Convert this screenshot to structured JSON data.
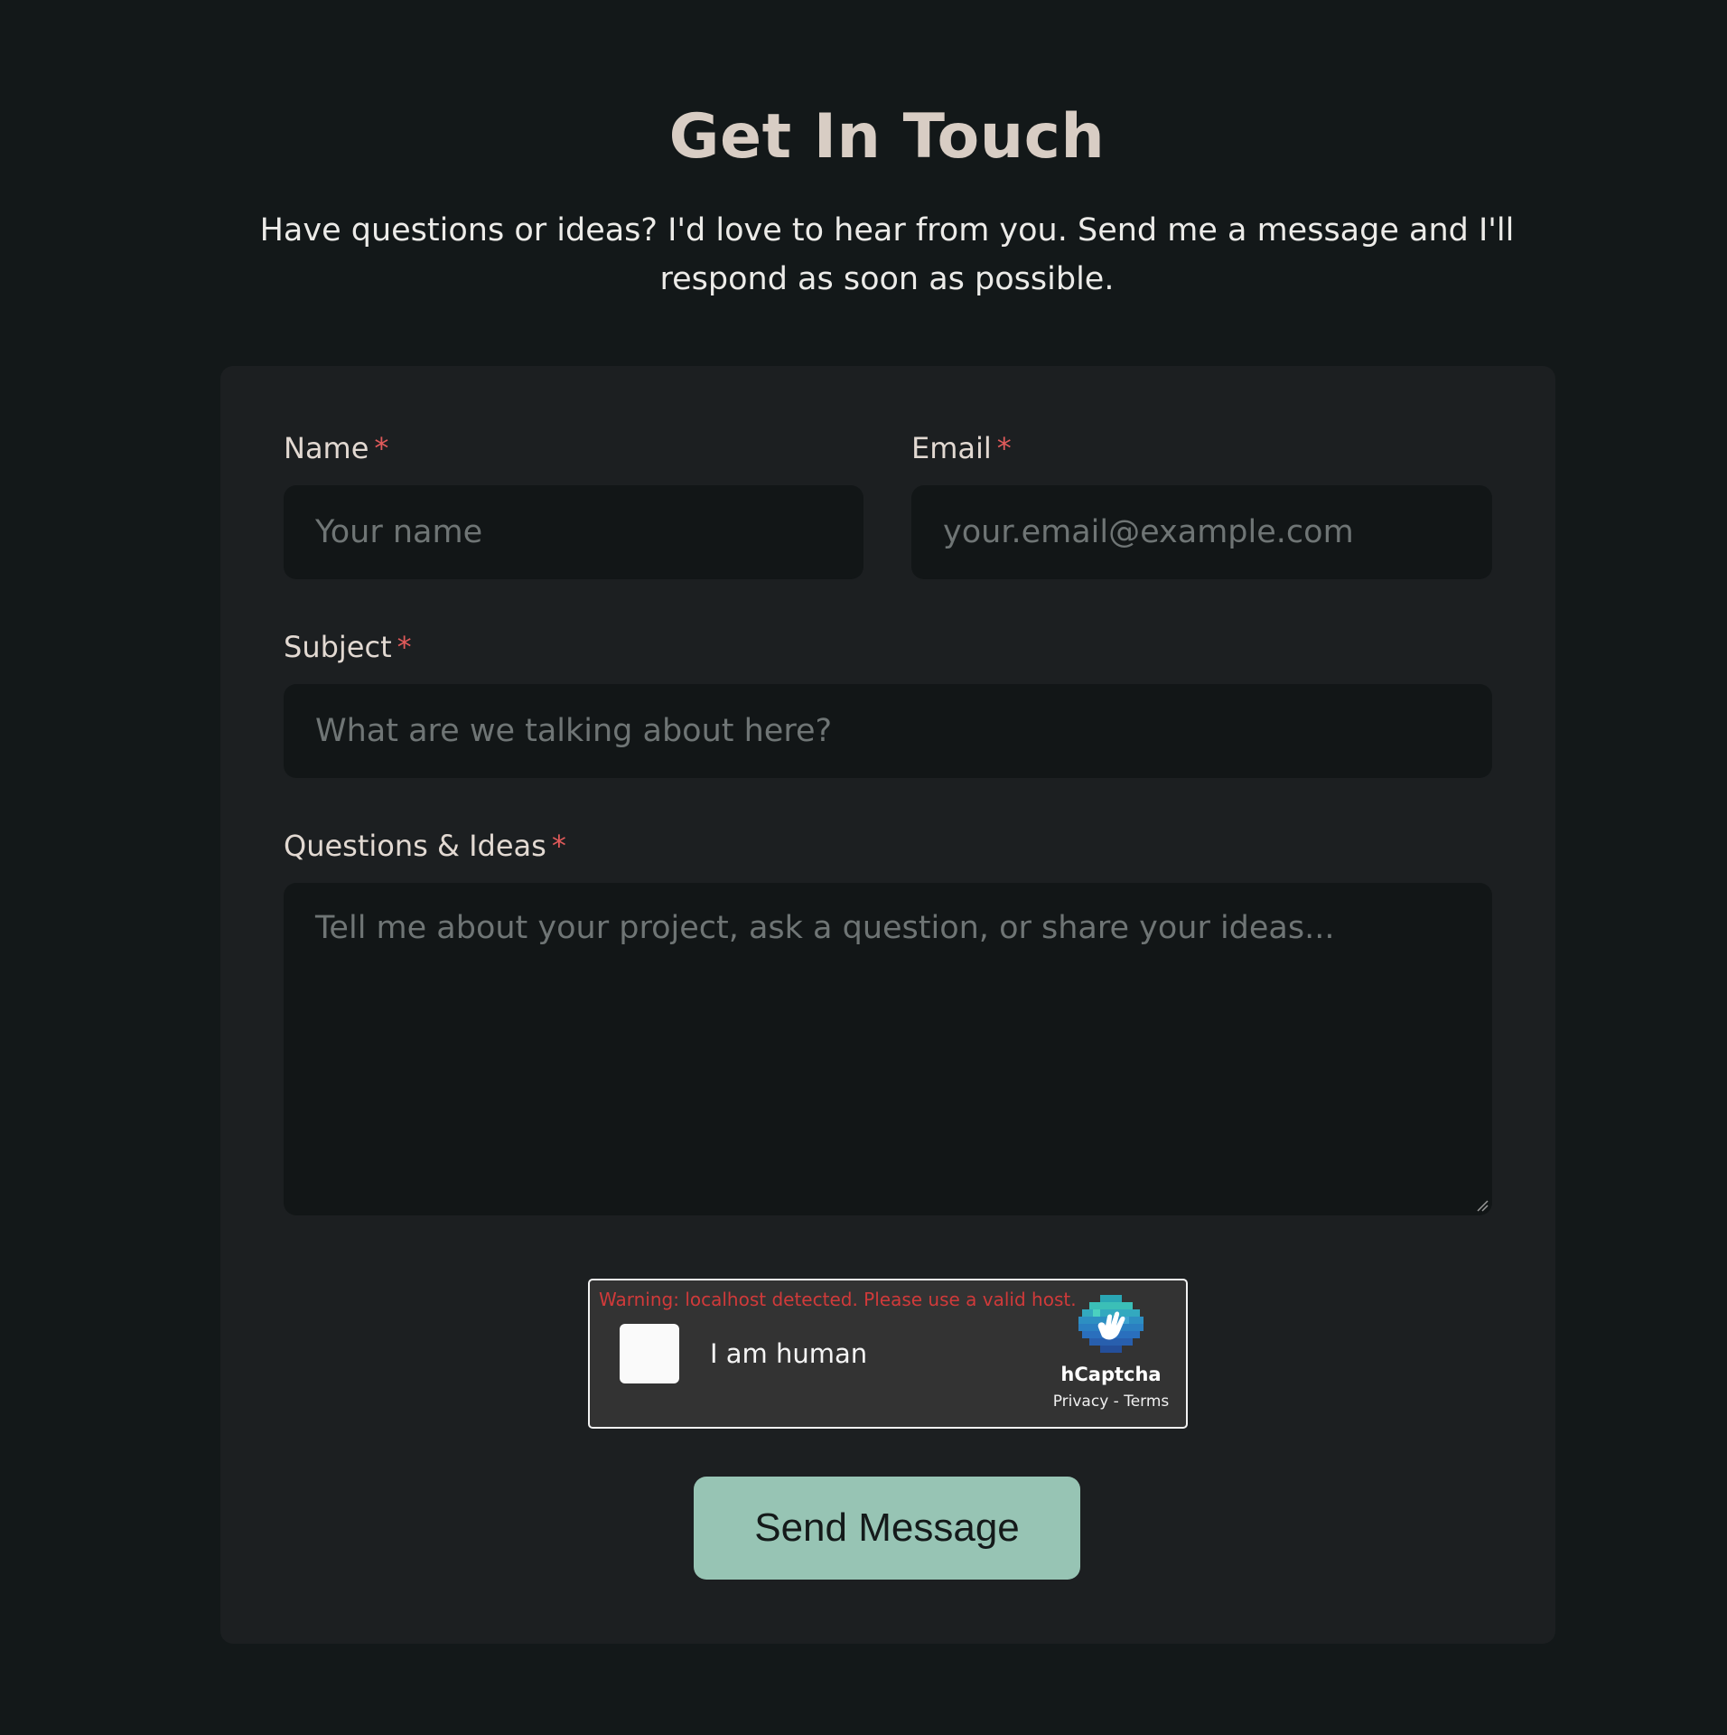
{
  "header": {
    "title": "Get In Touch",
    "subtitle": "Have questions or ideas? I'd love to hear from you. Send me a message and I'll respond as soon as possible."
  },
  "form": {
    "required_mark": "*",
    "name": {
      "label": "Name",
      "placeholder": "Your name"
    },
    "email": {
      "label": "Email",
      "placeholder": "your.email@example.com"
    },
    "subject": {
      "label": "Subject",
      "placeholder": "What are we talking about here?"
    },
    "message": {
      "label": "Questions & Ideas",
      "placeholder": "Tell me about your project, ask a question, or share your ideas..."
    },
    "submit_label": "Send Message"
  },
  "captcha": {
    "warning": "Warning: localhost detected. Please use a valid host.",
    "checkbox_label": "I am human",
    "brand": "hCaptcha",
    "privacy_link": "Privacy",
    "separator": " - ",
    "terms_link": "Terms"
  },
  "colors": {
    "background": "#131819",
    "card": "#1c1f21",
    "input": "#121617",
    "accent": "#97c4b4",
    "required": "#e05a5a",
    "captcha_warning": "#d03a3a"
  }
}
